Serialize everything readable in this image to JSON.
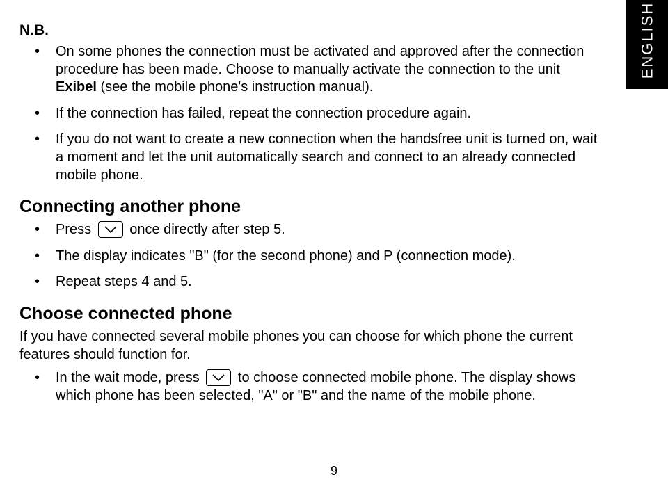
{
  "lang_tab": "ENGLISH",
  "nb_label": "N.B.",
  "nb_items": [
    {
      "pre": "On some phones the connection must be activated and approved after the connection procedure has been made. Choose to manually activate the connection to the unit ",
      "bold": "Exibel",
      "post": " (see the mobile phone's instruction manual)."
    },
    {
      "text": "If the connection has failed, repeat the connection procedure again."
    },
    {
      "text": "If you do not want to create a new connection when the handsfree unit is turned on, wait a moment and let the unit automatically search and connect to an already connected mobile phone."
    }
  ],
  "section_connect": {
    "title": "Connecting another phone",
    "items": [
      {
        "press": "Press ",
        "after": " once directly after step 5."
      },
      {
        "text": "The display indicates \"B\" (for the second phone) and P (connection mode)."
      },
      {
        "text": "Repeat steps 4 and 5."
      }
    ]
  },
  "section_choose": {
    "title": "Choose connected phone",
    "intro": "If you have connected several mobile phones you can choose for which phone the current features should function for.",
    "item": {
      "pre": "In the wait mode, press ",
      "post": " to choose connected mobile phone. The display shows which phone has been selected, \"A\" or \"B\" and the name of the mobile phone."
    }
  },
  "page_number": "9"
}
